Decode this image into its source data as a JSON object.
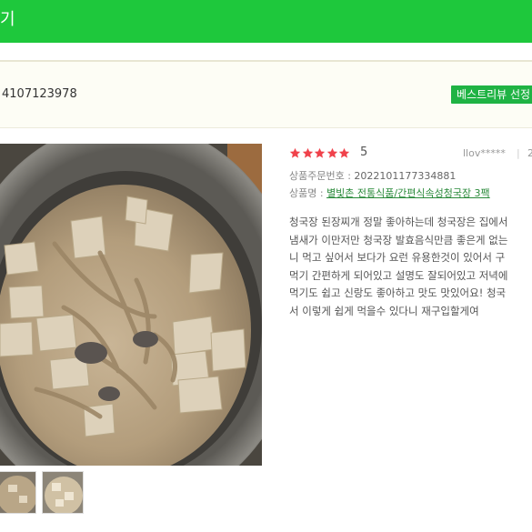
{
  "header": {
    "title": "기"
  },
  "order": {
    "number": "4107123978",
    "badge": "베스트리뷰 선정"
  },
  "review": {
    "rating": "5",
    "stars_filled": 5,
    "user": "llov*****",
    "separator": "|",
    "date_fragment": "2",
    "order_label": "상품주문번호 : ",
    "order_number": "2022101177334881",
    "product_label": "상품명 : ",
    "product_name": "별빛촌 전통식품/간편식속성청국장 3팩",
    "text_lines": [
      "청국장 된장찌개 정말 좋아하는데 청국장은 집에서",
      "냄새가 이만저만 청국장 발효음식만큼 좋은게 없는",
      "니 먹고 싶어서 보다가 요런 유용한것이 있어서 구",
      "먹기 간편하게 되어있고 설명도 잘되어있고 저녁에",
      "먹기도 쉽고 신랑도 좋아하고 맛도 맛있어요! 청국",
      "서 이렇게 쉽게 먹을수 있다니 재구입할게여"
    ]
  },
  "colors": {
    "brand_green": "#1ec83c",
    "badge_green": "#1fb344",
    "star_red": "#f0424b",
    "link_green": "#2a8a3a"
  },
  "icons": {
    "star": "star-icon"
  }
}
